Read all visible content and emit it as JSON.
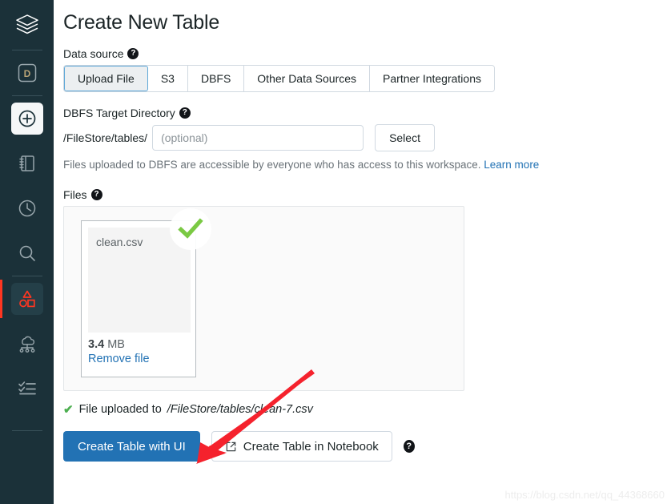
{
  "sidebar": {
    "logo": {
      "name": "databricks-logo"
    },
    "items": [
      {
        "id": "workspace-d",
        "icon": "letter-d-badge-icon",
        "state": "default"
      },
      {
        "id": "create-new",
        "icon": "plus-circle-icon",
        "state": "active-light"
      },
      {
        "id": "workspace",
        "icon": "notebook-icon",
        "state": "default"
      },
      {
        "id": "recents",
        "icon": "clock-icon",
        "state": "default"
      },
      {
        "id": "search",
        "icon": "search-icon",
        "state": "default"
      },
      {
        "id": "data",
        "icon": "shapes-icon",
        "state": "selected"
      },
      {
        "id": "clusters",
        "icon": "cloud-cluster-icon",
        "state": "default"
      },
      {
        "id": "jobs",
        "icon": "checklist-icon",
        "state": "default"
      }
    ]
  },
  "page": {
    "title": "Create New Table"
  },
  "data_source": {
    "label": "Data source",
    "help": "?",
    "tabs": [
      {
        "label": "Upload File",
        "active": true
      },
      {
        "label": "S3",
        "active": false
      },
      {
        "label": "DBFS",
        "active": false
      },
      {
        "label": "Other Data Sources",
        "active": false
      },
      {
        "label": "Partner Integrations",
        "active": false
      }
    ]
  },
  "target_directory": {
    "label": "DBFS Target Directory",
    "help": "?",
    "prefix": "/FileStore/tables/",
    "input_value": "",
    "input_placeholder": "(optional)",
    "select_button": "Select",
    "hint_text": "Files uploaded to DBFS are accessible by everyone who has access to this workspace.",
    "hint_link": "Learn more"
  },
  "files": {
    "label": "Files",
    "help": "?",
    "card": {
      "filename": "clean.csv",
      "size_value": "3.4",
      "size_unit": "MB",
      "remove_label": "Remove file",
      "check_icon": "green-check-icon"
    }
  },
  "status": {
    "check_icon": "green-check-icon",
    "prefix": "File uploaded to ",
    "path": "/FileStore/tables/clean-7.csv"
  },
  "actions": {
    "primary_label": "Create Table with UI",
    "secondary_label": "Create Table in Notebook",
    "secondary_icon": "external-link-icon",
    "help": "?"
  },
  "annotation": {
    "arrow_color": "#f5222d",
    "name": "red-arrow-annotation"
  },
  "watermark": {
    "text": "https://blog.csdn.net/qq_44368660"
  },
  "colors": {
    "sidebar_bg": "#1b3139",
    "accent_red": "#ff3621",
    "primary_blue": "#2272b4",
    "link_blue": "#2272b4",
    "green": "#7ac943"
  }
}
